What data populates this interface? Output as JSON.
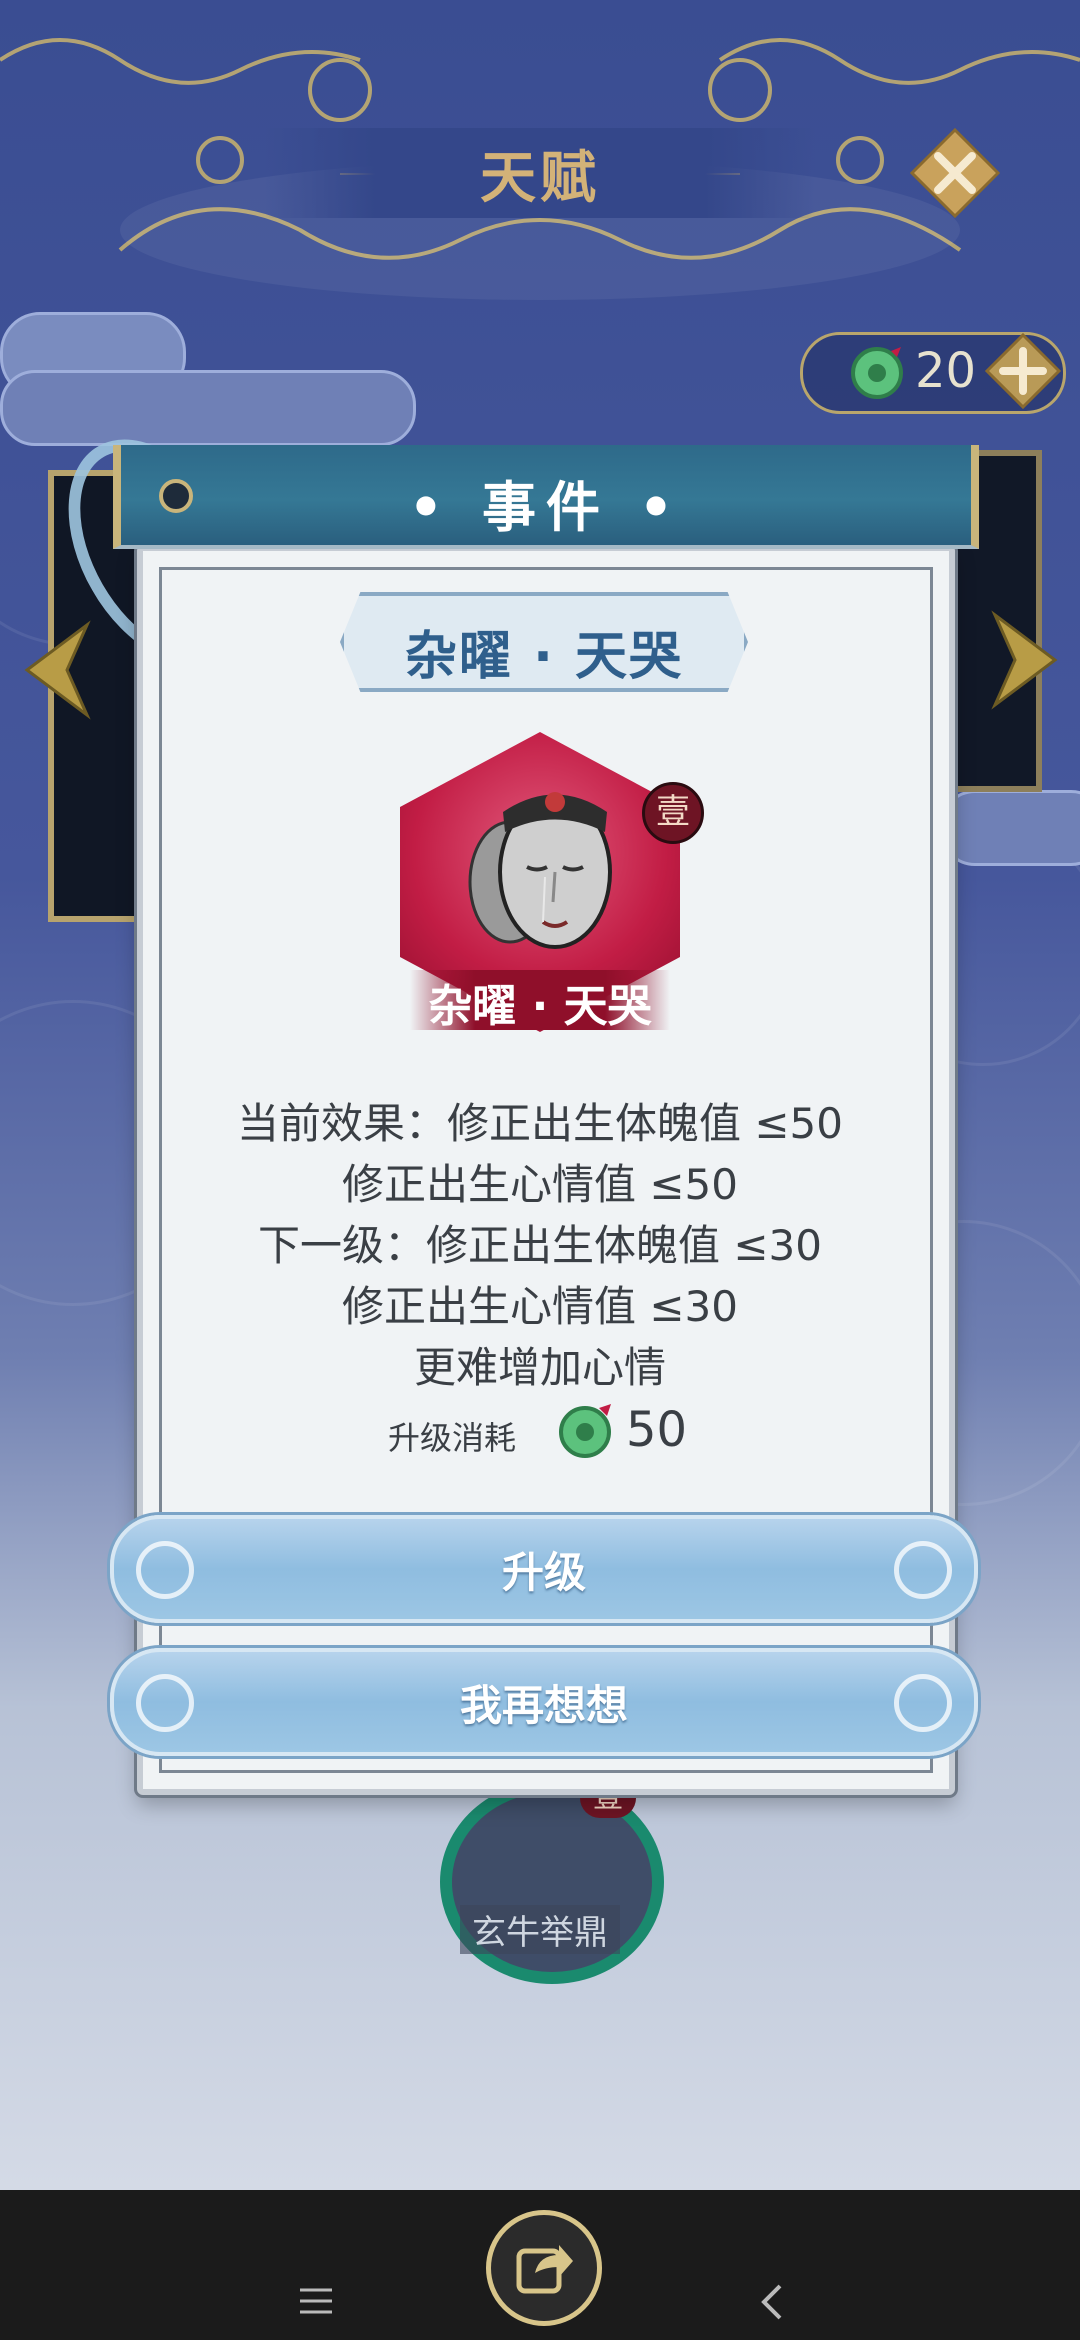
{
  "page": {
    "title": "天赋",
    "currency_value": "20"
  },
  "modal": {
    "header_title": "• 事件 •",
    "event_name": "杂曜 · 天哭",
    "card_caption": "杂曜 · 天哭",
    "level_badge": "壹",
    "description_lines": [
      "当前效果：修正出生体魄值 ≤50",
      "修正出生心情值 ≤50",
      "下一级：修正出生体魄值 ≤30",
      "修正出生心情值 ≤30",
      "更难增加心情"
    ],
    "cost_label": "升级消耗",
    "cost_value": "50",
    "upgrade_button": "升级",
    "cancel_button": "我再想想"
  },
  "background_card": {
    "caption": "玄牛举鼎",
    "badge": "壹"
  },
  "colors": {
    "background": "#46579c",
    "header": "#357895",
    "button": "#9cc6e4",
    "hex_card": "#c21d45",
    "gold": "#cfb16f"
  },
  "icons": [
    "close-icon",
    "coin-icon",
    "plus-icon",
    "arrow-left-icon",
    "arrow-right-icon",
    "share-icon",
    "menu-icon",
    "back-icon"
  ]
}
